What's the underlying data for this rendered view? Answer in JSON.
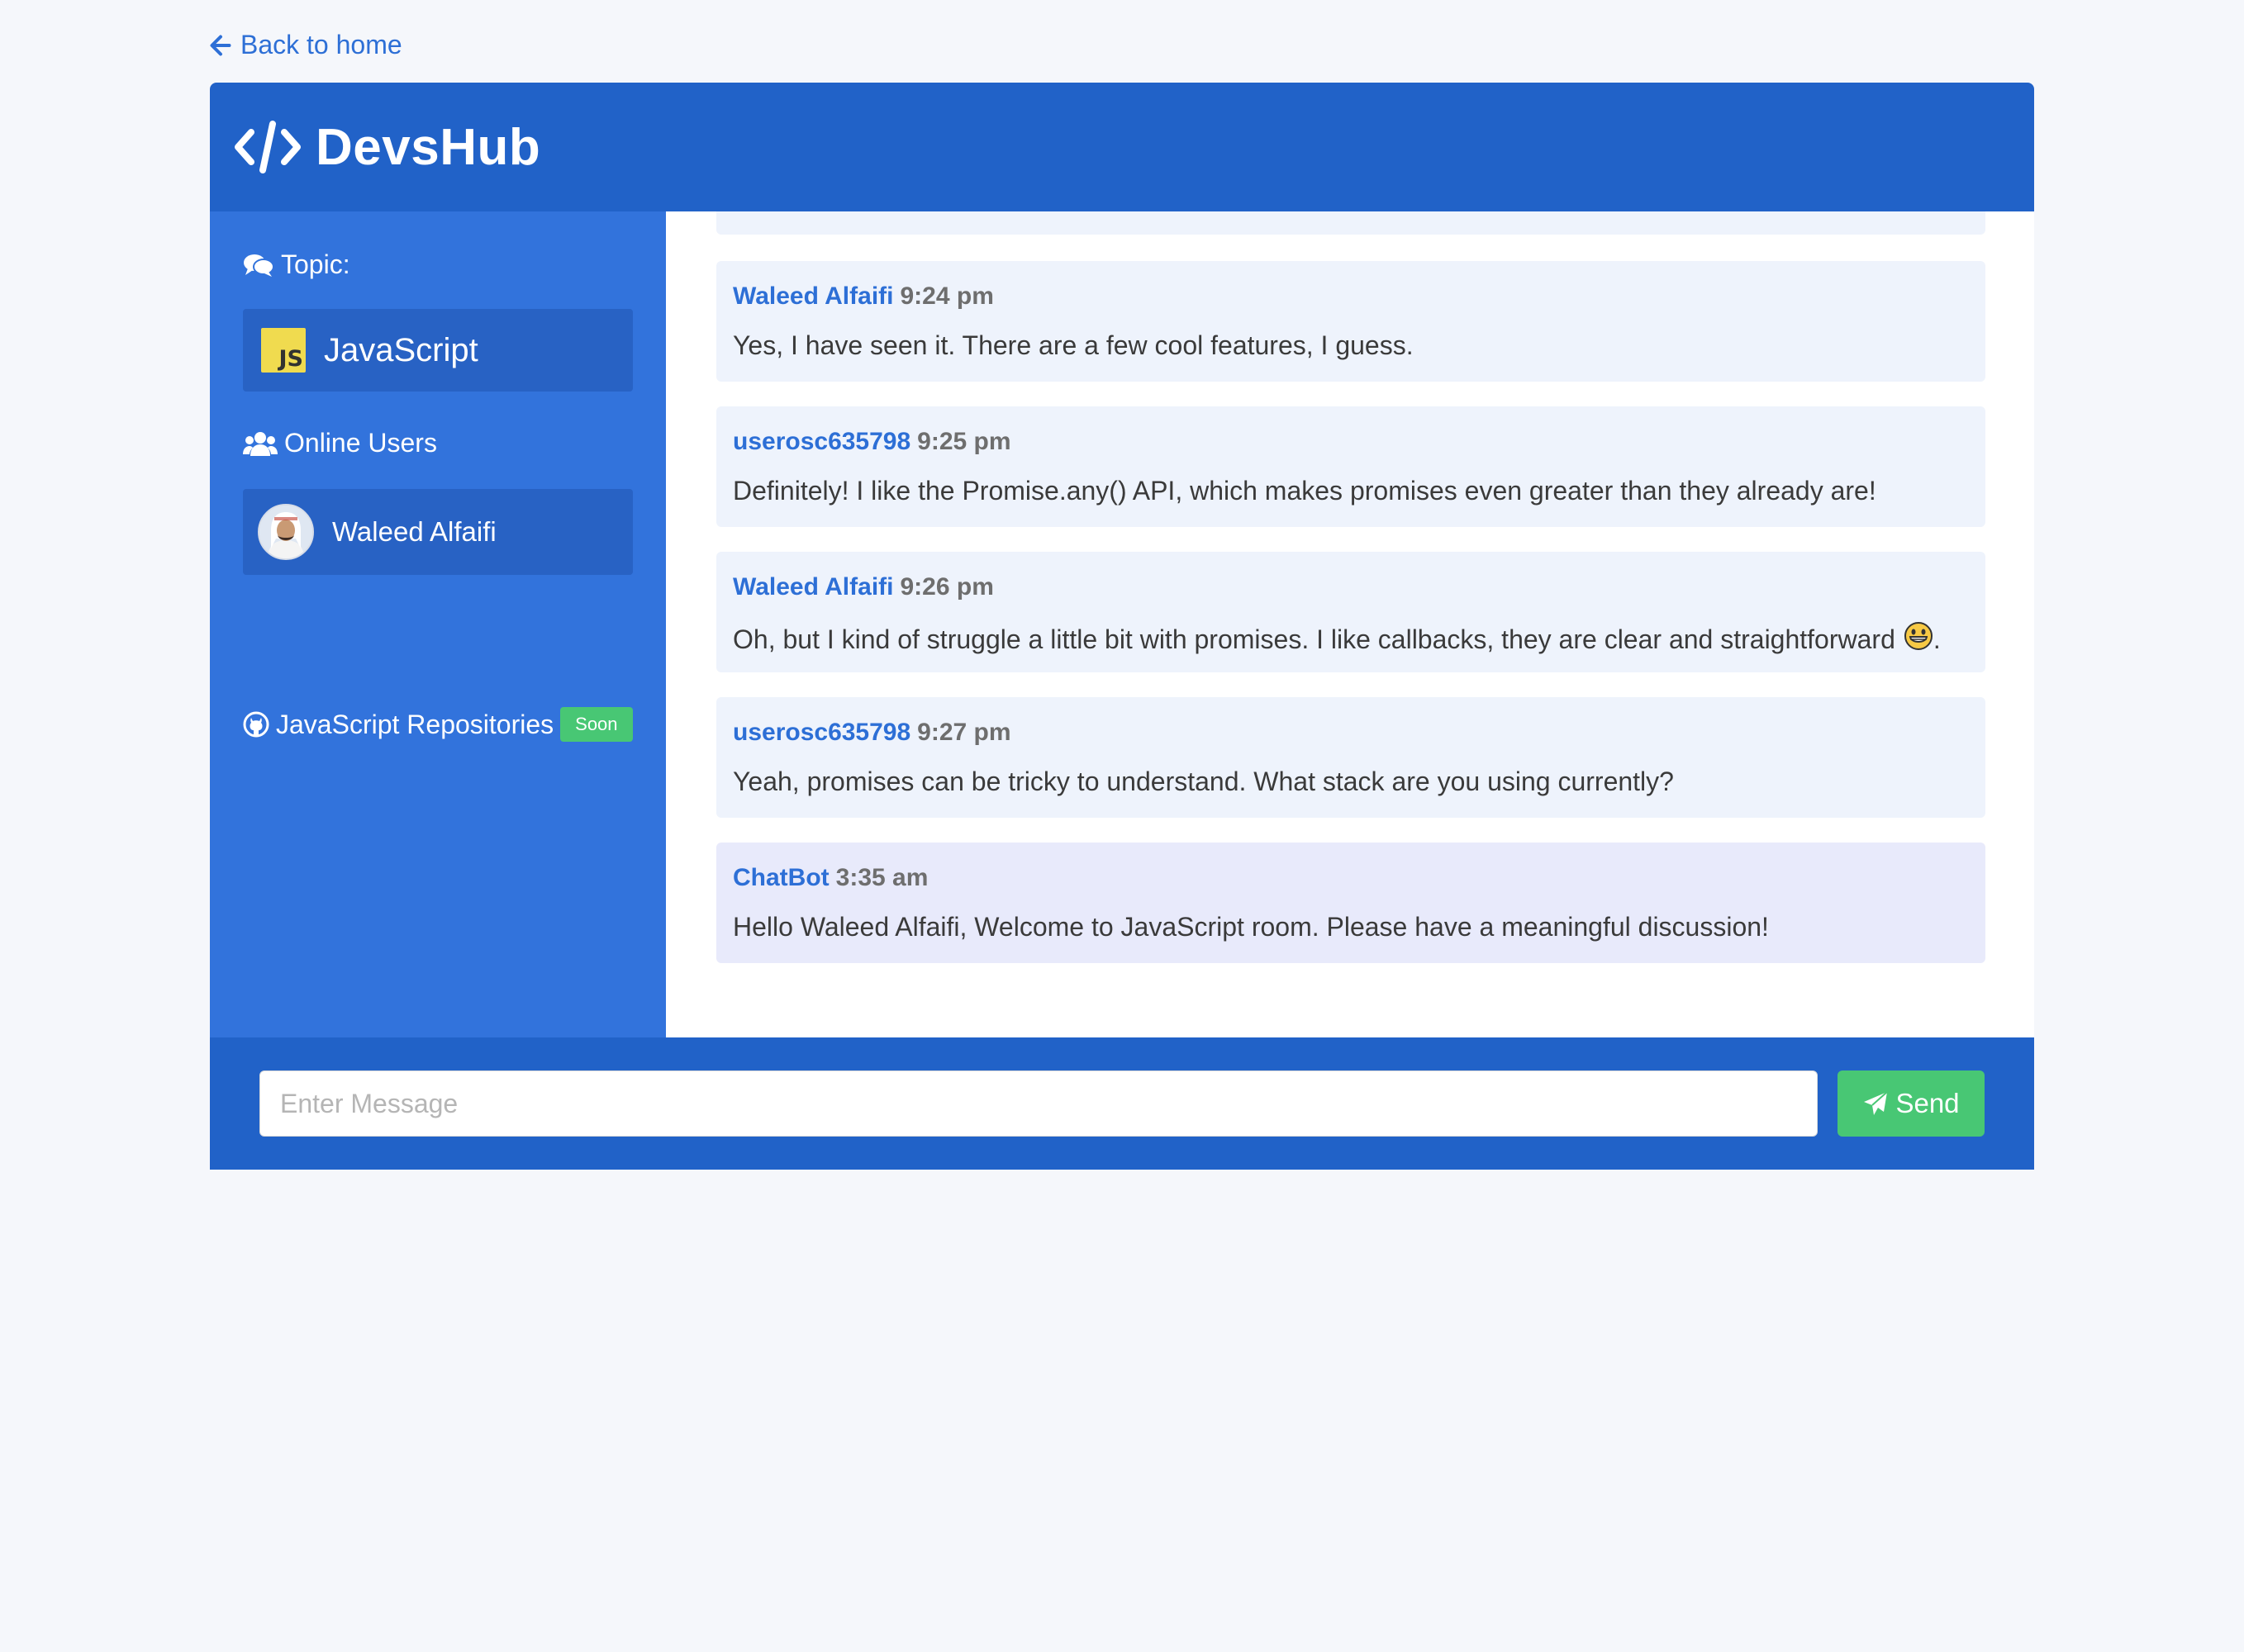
{
  "nav": {
    "back_label": "Back to home",
    "back_icon": "arrow-left-icon"
  },
  "header": {
    "brand": "DevsHub",
    "logo_icon": "code-icon"
  },
  "sidebar": {
    "topic_heading": "Topic:",
    "topic_heading_icon": "comments-icon",
    "topic": {
      "name": "JavaScript",
      "logo_text": "JS",
      "logo_color": "#f0db4f"
    },
    "online_heading": "Online Users",
    "online_heading_icon": "users-icon",
    "online_users": [
      {
        "name": "Waleed Alfaifi"
      }
    ],
    "repos_label": "JavaScript Repositories",
    "repos_icon": "github-icon",
    "repos_badge": "Soon"
  },
  "messages": [
    {
      "author": "Waleed Alfaifi",
      "time": "9:24 pm",
      "text": "Yes, I have seen it. There are a few cool features, I guess."
    },
    {
      "author": "userosc635798",
      "time": "9:25 pm",
      "text": "Definitely! I like the Promise.any() API, which makes promises even greater than they already are!"
    },
    {
      "author": "Waleed Alfaifi",
      "time": "9:26 pm",
      "text": "Oh, but I kind of struggle a little bit with promises. I like callbacks, they are clear and straightforward",
      "emoji": "grinning-face",
      "suffix": "."
    },
    {
      "author": "userosc635798",
      "time": "9:27 pm",
      "text": "Yeah, promises can be tricky to understand. What stack are you using currently?"
    },
    {
      "author": "ChatBot",
      "time": "3:35 am",
      "text": "Hello Waleed Alfaifi, Welcome to JavaScript room. Please have a meaningful discussion!",
      "bot": true
    }
  ],
  "composer": {
    "placeholder": "Enter Message",
    "value": "",
    "send_label": "Send",
    "send_icon": "paper-plane-icon"
  },
  "colors": {
    "primary": "#2162c8",
    "sidebar": "#3273dc",
    "link": "#2d6fd6",
    "success": "#48c774",
    "message_bg": "#eef3fc",
    "bot_message_bg": "#e8eafb"
  }
}
